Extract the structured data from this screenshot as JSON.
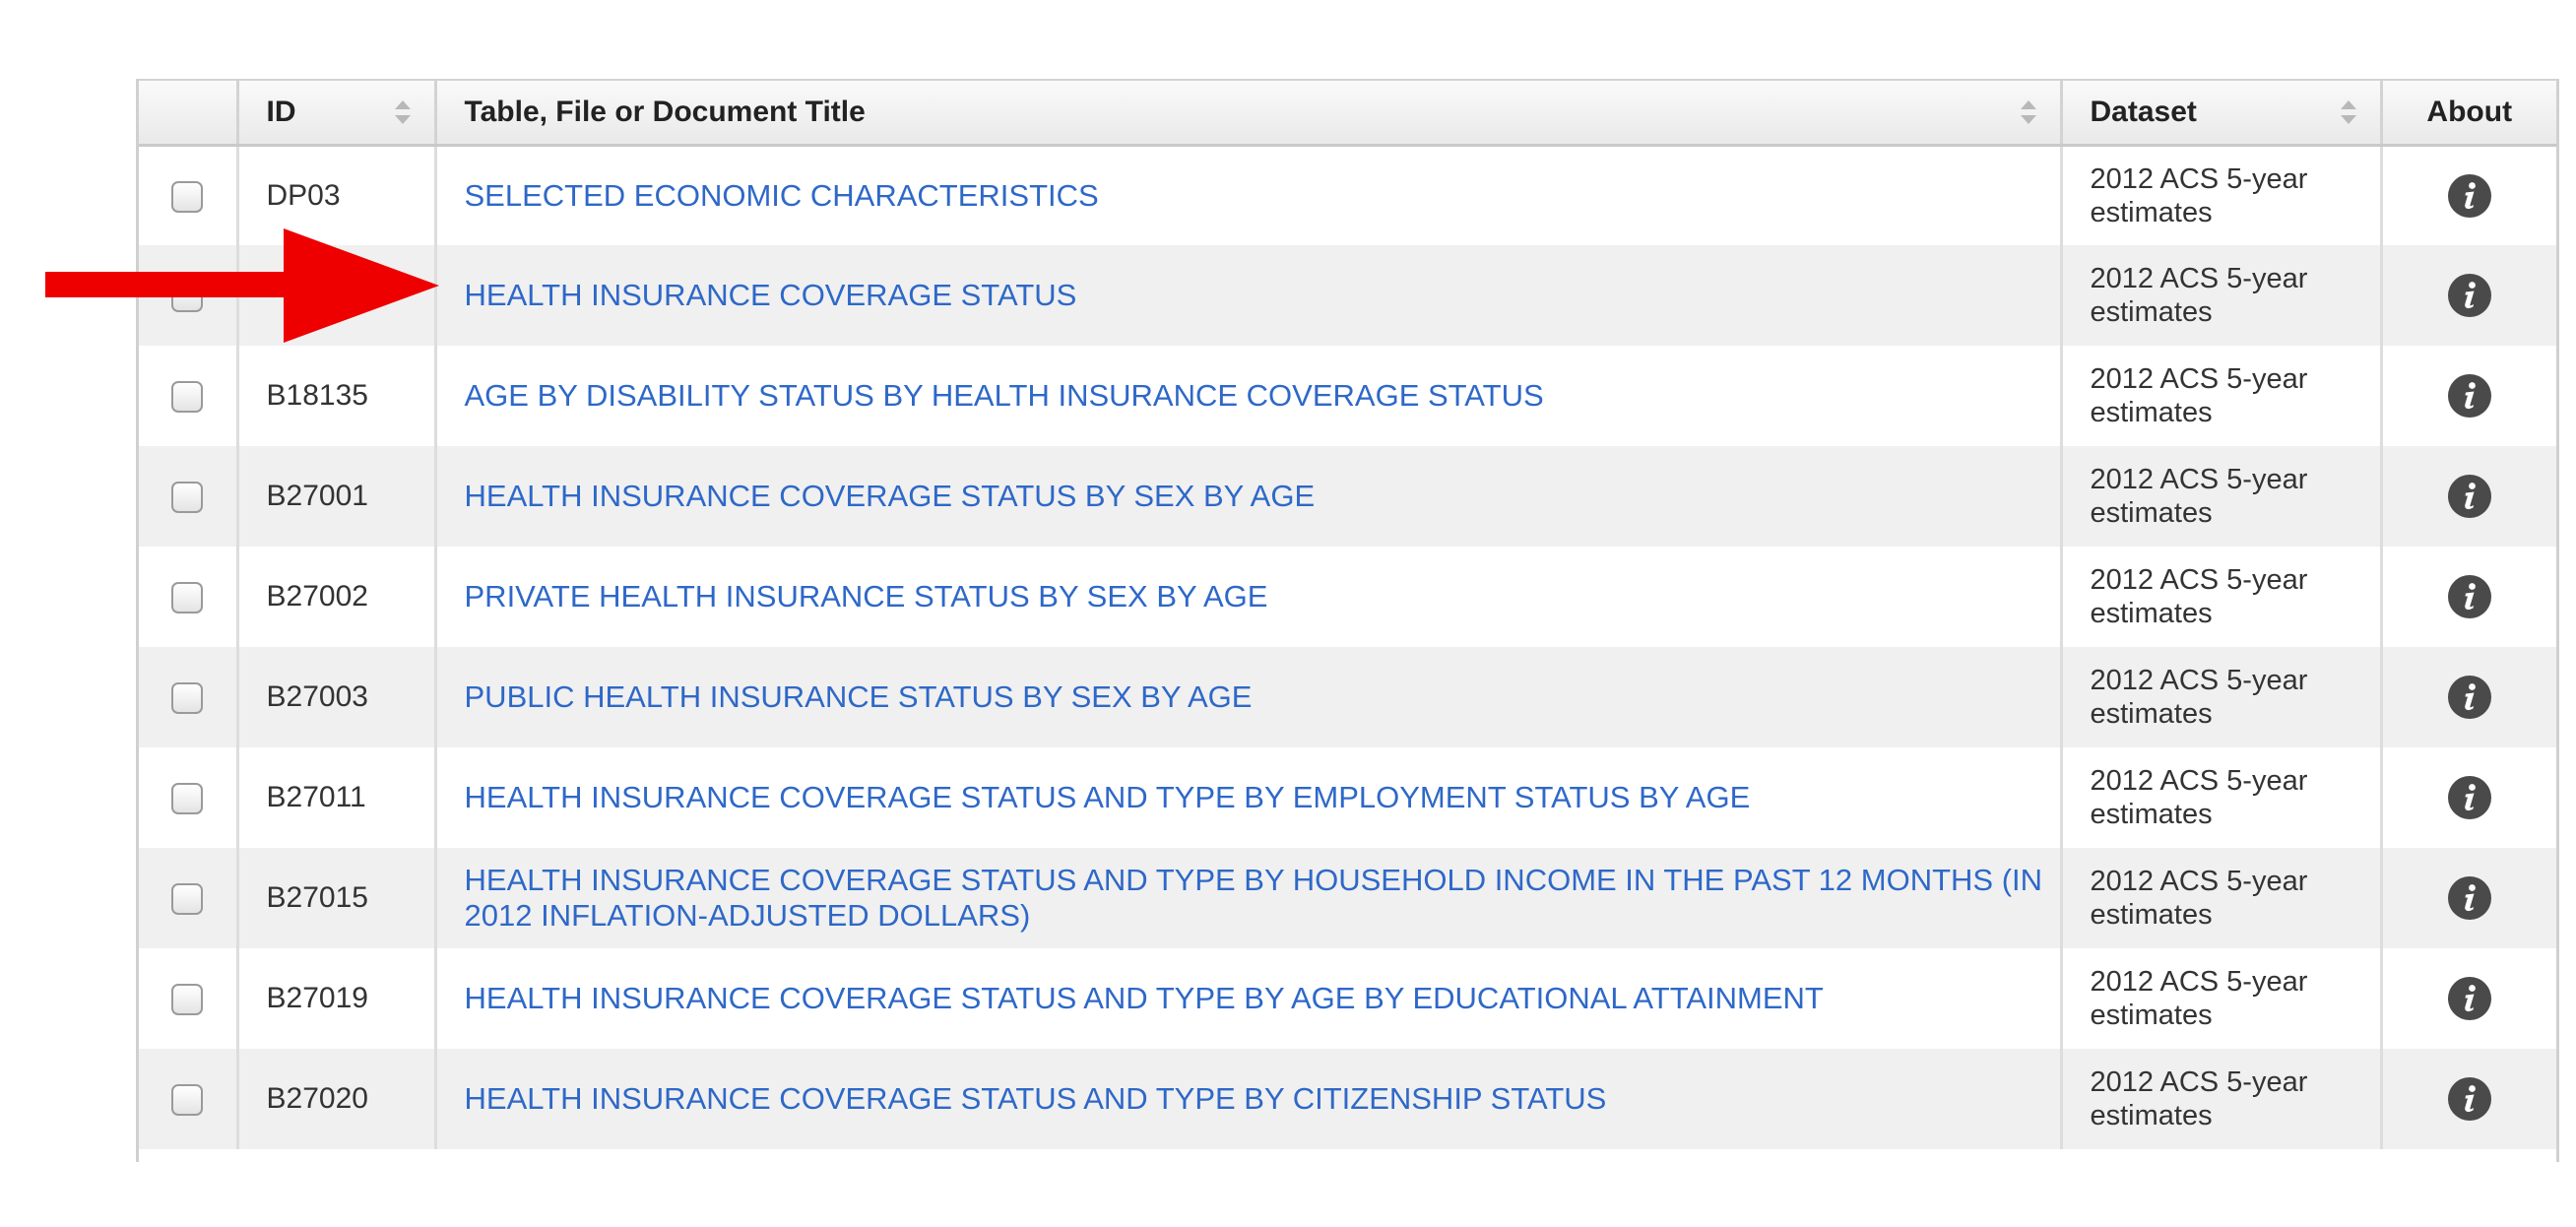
{
  "table": {
    "headers": {
      "id": "ID",
      "title": "Table, File or Document Title",
      "dataset": "Dataset",
      "about": "About"
    },
    "rows": [
      {
        "id": "DP03",
        "title": "SELECTED ECONOMIC CHARACTERISTICS",
        "dataset": "2012 ACS 5-year estimates"
      },
      {
        "id": "",
        "title": "HEALTH INSURANCE COVERAGE STATUS",
        "dataset": "2012 ACS 5-year estimates"
      },
      {
        "id": "B18135",
        "title": "AGE BY DISABILITY STATUS BY HEALTH INSURANCE COVERAGE STATUS",
        "dataset": "2012 ACS 5-year estimates"
      },
      {
        "id": "B27001",
        "title": "HEALTH INSURANCE COVERAGE STATUS BY SEX BY AGE",
        "dataset": "2012 ACS 5-year estimates"
      },
      {
        "id": "B27002",
        "title": "PRIVATE HEALTH INSURANCE STATUS BY SEX BY AGE",
        "dataset": "2012 ACS 5-year estimates"
      },
      {
        "id": "B27003",
        "title": "PUBLIC HEALTH INSURANCE STATUS BY SEX BY AGE",
        "dataset": "2012 ACS 5-year estimates"
      },
      {
        "id": "B27011",
        "title": "HEALTH INSURANCE COVERAGE STATUS AND TYPE BY EMPLOYMENT STATUS BY AGE",
        "dataset": "2012 ACS 5-year estimates"
      },
      {
        "id": "B27015",
        "title": "HEALTH INSURANCE COVERAGE STATUS AND TYPE BY HOUSEHOLD INCOME IN THE PAST 12 MONTHS (IN 2012 INFLATION-ADJUSTED DOLLARS)",
        "dataset": "2012 ACS 5-year estimates"
      },
      {
        "id": "B27019",
        "title": "HEALTH INSURANCE COVERAGE STATUS AND TYPE BY AGE BY EDUCATIONAL ATTAINMENT",
        "dataset": "2012 ACS 5-year estimates"
      },
      {
        "id": "B27020",
        "title": "HEALTH INSURANCE COVERAGE STATUS AND TYPE BY CITIZENSHIP STATUS",
        "dataset": "2012 ACS 5-year estimates"
      }
    ]
  },
  "icons": {
    "sort": "sort-arrows-icon",
    "about": "info-icon",
    "annotation": "red-arrow-icon"
  },
  "colors": {
    "link": "#2e68c8",
    "arrow": "#ee0000",
    "info_icon": "#4a4a4a",
    "row_alt": "#f0f0f0"
  }
}
